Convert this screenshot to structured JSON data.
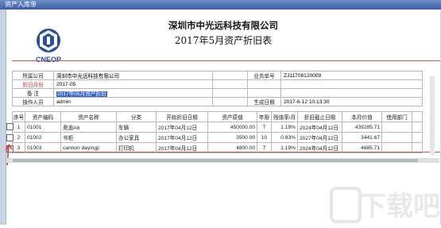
{
  "window": {
    "title": "资产入库单"
  },
  "header": {
    "logo_text": "CNEOP",
    "company": "深圳市中光远科技有限公司",
    "report_title": "2017年5月资产折旧表"
  },
  "info": {
    "company_label": "所属公司",
    "company_value": "深圳市中光远科技有限公司",
    "doc_no_label": "业务单号",
    "doc_no_value": "ZJ11708120009",
    "period_label": "折旧月份",
    "period_value": "2017-05",
    "remark_label": "备  注",
    "remark_value": "2017年05月资产折旧",
    "operator_label": "操作人员",
    "operator_value": "admin",
    "created_label": "生成日期",
    "created_value": "2017-6-12 10:13:30"
  },
  "table": {
    "headers": [
      "序号",
      "资产编码",
      "资产名称",
      "分类",
      "开始折旧日期",
      "资产原值",
      "年限",
      "残值率/月",
      "折旧截止日期",
      "本月价值",
      "使用部门",
      ""
    ],
    "rows": [
      [
        "1",
        "01001",
        "奥迪A6",
        "车辆",
        "2017年04月12日",
        "450000.00",
        "7",
        "1.19%",
        "2024年04月12日",
        "439285.71",
        "",
        ""
      ],
      [
        "2",
        "01002",
        "书柜",
        "办公家具",
        "2017年04月12日",
        "3500.00",
        "10",
        "0.83%",
        "2027年04月12日",
        "3441.67",
        "",
        ""
      ],
      [
        "3",
        "01003",
        "cannon dayingji",
        "打印机",
        "2017年04月12日",
        "4800.00",
        "7",
        "1.19%",
        "2024年04月12日",
        "4685.71",
        "",
        ""
      ]
    ]
  },
  "watermark": {
    "text": "下载吧"
  },
  "colors": {
    "accent_red": "#d25050",
    "title_bar": "#3c5fa6",
    "selection": "#3a67c9"
  }
}
